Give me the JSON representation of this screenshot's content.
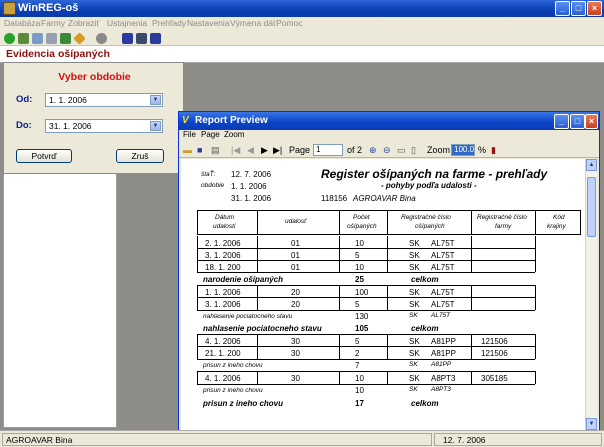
{
  "app": {
    "title": "WinREG-oš"
  },
  "menu": [
    "Databáza",
    "Farmy",
    "Zobraziť",
    "Ustajnenia",
    "Prehľady",
    "Nastavenia",
    "Výmena dát",
    "Pomoc"
  ],
  "document": {
    "title": "Evidencia ošípaných"
  },
  "period_dialog": {
    "heading": "Vyber obdobie",
    "from_label": "Od:",
    "from_value": "1. 1. 2006",
    "to_label": "Do:",
    "to_value": "31. 1. 2006",
    "ok": "Potvrď",
    "cancel": "Zruš"
  },
  "preview": {
    "title": "Report Preview",
    "menu": [
      "File",
      "Page",
      "Zoom"
    ],
    "page_label": "Page",
    "page_value": "1",
    "of_label": "of 2",
    "zoom_label": "Zoom",
    "zoom_value": "100.0",
    "zoom_unit": "%"
  },
  "report": {
    "title": "Register ošípaných na farme - prehľady",
    "subtitle": "- pohyby podľa udalosti -",
    "stav_label": "štaŤ:",
    "stav_date": "12. 7. 2006",
    "obdobie_label": "obdobie",
    "obdobie_from": "1. 1. 2006",
    "obdobie_to": "31. 1. 2006",
    "farm_code": "118156",
    "farm_name": "AGROAVAR Bina",
    "headers": {
      "datum": "Dátum",
      "datum2": "udalosti",
      "udalost": "udalosť",
      "pocet": "Počet",
      "pocet2": "ošípaných",
      "reg": "Registračné číslo",
      "reg2": "ošípaných",
      "regfarmy": "Registračné číslo",
      "regfarmy2": "farmy",
      "kod": "Kód",
      "kod2": "krajiny"
    },
    "rows": [
      {
        "date": "2. 1. 2006",
        "udalost": "01",
        "pocet": "10",
        "cc": "SK",
        "reg": "AL75T",
        "farm": ""
      },
      {
        "date": "3. 1. 2006",
        "udalost": "01",
        "pocet": "5",
        "cc": "SK",
        "reg": "AL75T",
        "farm": ""
      },
      {
        "date": "18. 1. 200",
        "udalost": "01",
        "pocet": "10",
        "cc": "SK",
        "reg": "AL75T",
        "farm": ""
      },
      {
        "date": "1. 1. 2006",
        "udalost": "20",
        "pocet": "100",
        "cc": "SK",
        "reg": "AL75T",
        "farm": ""
      },
      {
        "date": "3. 1. 2006",
        "udalost": "20",
        "pocet": "5",
        "cc": "SK",
        "reg": "AL75T",
        "farm": ""
      },
      {
        "date": "4. 1. 2006",
        "udalost": "30",
        "pocet": "5",
        "cc": "SK",
        "reg": "A81PP",
        "farm": "121506"
      },
      {
        "date": "21. 1. 200",
        "udalost": "30",
        "pocet": "2",
        "cc": "SK",
        "reg": "A81PP",
        "farm": "121506"
      },
      {
        "date": "4. 1. 2006",
        "udalost": "30",
        "pocet": "10",
        "cc": "SK",
        "reg": "A8PT3",
        "farm": "305185"
      }
    ],
    "groups": [
      {
        "label": "narodenie ošípaných",
        "total": "25",
        "celkom": "celkom"
      },
      {
        "sub_label": "nahlasenie pociatocneho stavu",
        "sub_count": "130",
        "sub_cc": "SK",
        "sub_reg": "AL75T",
        "label": "nahlasenie pociatocneho stavu",
        "total": "105",
        "celkom": "celkom"
      },
      {
        "sub_label": "prisun z ineho chovu",
        "sub_count": "7",
        "sub_cc": "SK",
        "sub_reg": "A81PP"
      },
      {
        "sub_label": "prisun z ineho chovu",
        "sub_count": "10",
        "sub_cc": "SK",
        "sub_reg": "A8PT3",
        "label": "prisun z ineho chovu",
        "total": "17",
        "celkom": "celkom"
      }
    ]
  },
  "status": {
    "left": "AGROAVAR Bina",
    "right": "12. 7. 2006"
  }
}
